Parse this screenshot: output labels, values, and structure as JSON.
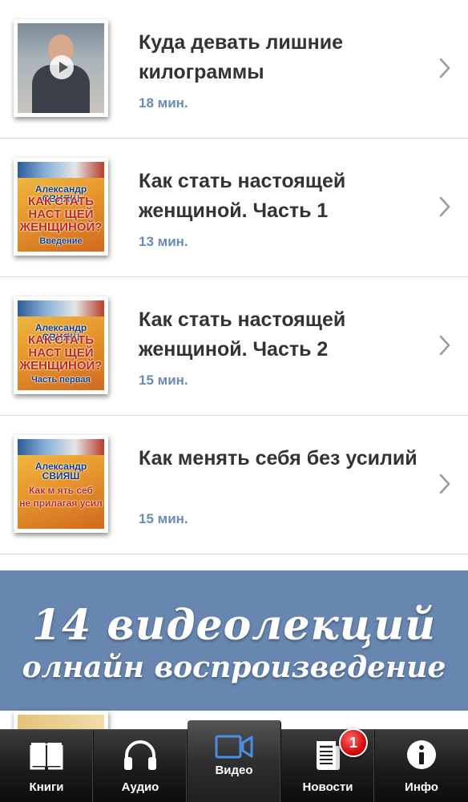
{
  "videos": [
    {
      "title": "Куда девать лишние килограммы",
      "duration": "18 мин."
    },
    {
      "title": "Как стать настоящей женщиной.  Часть 1",
      "duration": "13 мин.",
      "cover": {
        "author": "Александр СВИЯШ",
        "line1": "КАК СТАТЬ",
        "line2": "НАСТ ЩЕЙ",
        "line3": "ЖЕНЩИНОЙ?",
        "line4": "Введение"
      }
    },
    {
      "title": "Как стать настоящей женщиной.  Часть 2",
      "duration": "15 мин.",
      "cover": {
        "author": "Александр СВИЯШ",
        "line1": "КАК СТАТЬ",
        "line2": "НАСТ ЩЕЙ",
        "line3": "ЖЕНЩИНОЙ?",
        "line4": "Часть первая"
      }
    },
    {
      "title": "Как менять себя без усилий",
      "duration": "15 мин.",
      "cover": {
        "author": "Александр СВИЯШ",
        "line1": "Как м  ять себ",
        "line2": "не прилагая усил",
        "line3": "",
        "line4": ""
      }
    }
  ],
  "banner": {
    "line1": "14 видеолекций",
    "line2": "олнайн воспроизведение",
    "color": "#6786b0"
  },
  "tabbar": {
    "tabs": [
      {
        "label": "Книги",
        "icon": "book-icon"
      },
      {
        "label": "Аудио",
        "icon": "headphones-icon"
      },
      {
        "label": "Видео",
        "icon": "video-camera-icon",
        "active": true
      },
      {
        "label": "Новости",
        "icon": "newspaper-icon",
        "badge": "1"
      },
      {
        "label": "Инфо",
        "icon": "info-icon"
      }
    ],
    "active_color": "#4a90e2",
    "badge_color": "#d40d0d"
  }
}
